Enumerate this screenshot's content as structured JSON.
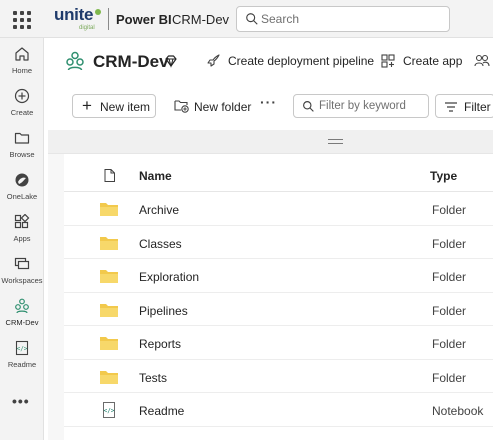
{
  "topbar": {
    "logo_text": "unite",
    "logo_sub": "digital",
    "product": "Power BI",
    "breadcrumb": "CRM-Dev",
    "search_placeholder": "Search"
  },
  "rail": {
    "items": [
      {
        "label": "Home",
        "icon": "home-icon"
      },
      {
        "label": "Create",
        "icon": "create-icon"
      },
      {
        "label": "Browse",
        "icon": "browse-icon"
      },
      {
        "label": "OneLake",
        "icon": "onelake-icon"
      },
      {
        "label": "Apps",
        "icon": "apps-icon"
      },
      {
        "label": "Workspaces",
        "icon": "workspaces-icon"
      },
      {
        "label": "CRM-Dev",
        "icon": "workspace-icon"
      },
      {
        "label": "Readme",
        "icon": "notebook-icon"
      }
    ],
    "more": "•••"
  },
  "workspace": {
    "title": "CRM-Dev",
    "create_pipeline": "Create deployment pipeline",
    "create_app": "Create app"
  },
  "toolbar": {
    "new_item": "New item",
    "new_folder": "New folder",
    "more": "···",
    "filter_placeholder": "Filter by keyword",
    "filter": "Filter"
  },
  "table": {
    "col_name": "Name",
    "col_type": "Type",
    "rows": [
      {
        "name": "Archive",
        "type": "Folder",
        "icon": "folder-icon"
      },
      {
        "name": "Classes",
        "type": "Folder",
        "icon": "folder-icon"
      },
      {
        "name": "Exploration",
        "type": "Folder",
        "icon": "folder-icon"
      },
      {
        "name": "Pipelines",
        "type": "Folder",
        "icon": "folder-icon"
      },
      {
        "name": "Reports",
        "type": "Folder",
        "icon": "folder-icon"
      },
      {
        "name": "Tests",
        "type": "Folder",
        "icon": "folder-icon"
      },
      {
        "name": "Readme",
        "type": "Notebook",
        "icon": "notebook-icon"
      }
    ]
  },
  "colors": {
    "folder": "#f2c94c",
    "accent": "#117865",
    "workspace_icon": "#2f8f6f"
  }
}
